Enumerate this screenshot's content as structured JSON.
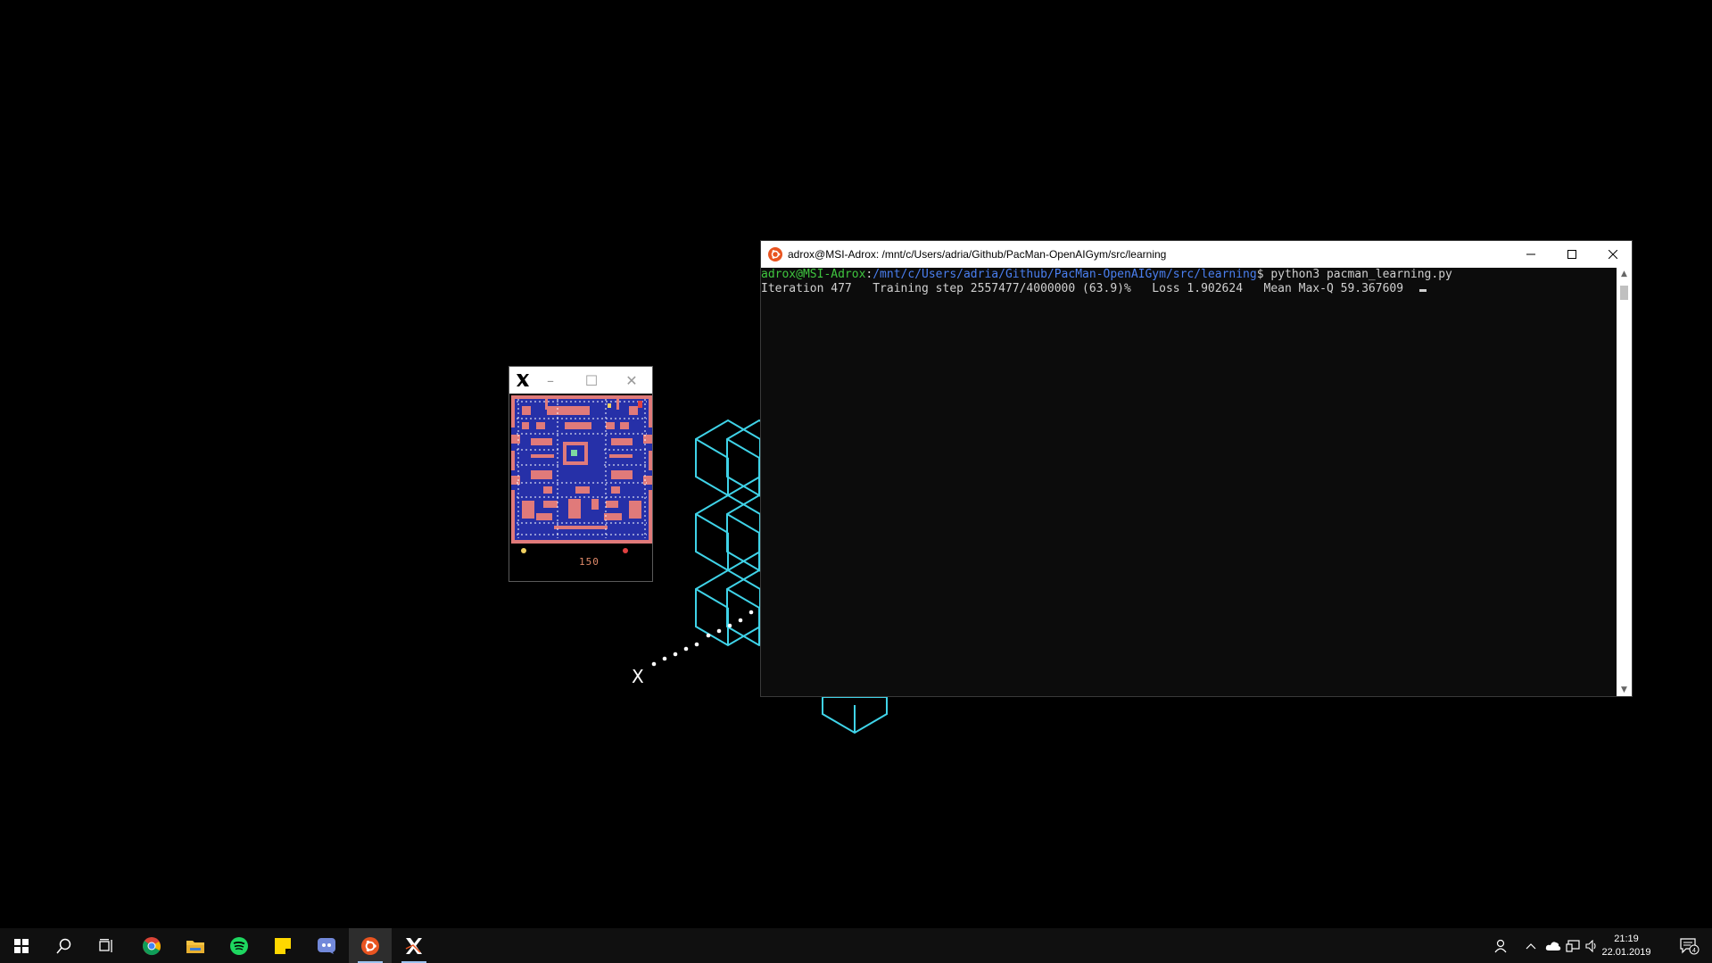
{
  "wallpaper": {
    "letter": "X"
  },
  "pacman_window": {
    "minimize": "–",
    "maximize": "☐",
    "close": "✕",
    "score": "150"
  },
  "terminal": {
    "title": "adrox@MSI-Adrox: /mnt/c/Users/adria/Github/PacMan-OpenAIGym/src/learning",
    "prompt_user": "adrox@MSI-Adrox",
    "prompt_sep": ":",
    "prompt_path": "/mnt/c/Users/adria/Github/PacMan-OpenAIGym/src/learning",
    "prompt_cmd": "$ python3 pacman_learning.py",
    "output_line": "Iteration 477   Training step 2557477/4000000 (63.9)%   Loss 1.902624   Mean Max-Q 59.367609"
  },
  "taskbar": {
    "apps": [
      "start-icon",
      "search-icon",
      "task-view-icon",
      "chrome-icon",
      "file-explorer-icon",
      "spotify-icon",
      "sticky-notes-icon",
      "discord-icon",
      "ubuntu-terminal-icon",
      "x-server-icon"
    ],
    "clock_time": "21:19",
    "clock_date": "22.01.2019",
    "notification_count": "4"
  },
  "colors": {
    "accent_cyan": "#3fd3e8",
    "maze_blue": "#2630a8",
    "maze_wall": "#e07a7a",
    "prompt_green": "#3fc63f",
    "prompt_blue": "#4a7ff0"
  }
}
